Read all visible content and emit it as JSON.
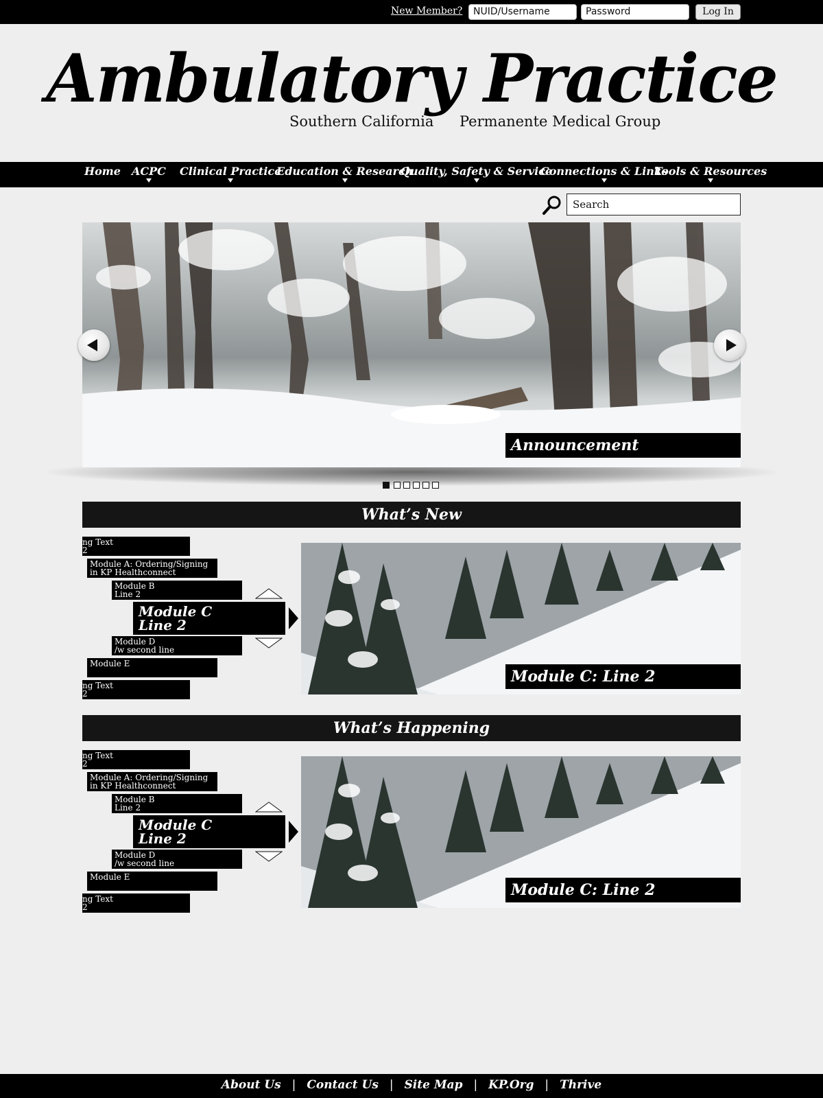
{
  "topbar": {
    "new_member": "New Member?",
    "username_placeholder": "NUID/Username",
    "password_placeholder": "Password",
    "login_label": "Log In"
  },
  "masthead": {
    "title": "Ambulatory Practice",
    "subtitle_left": "Southern California",
    "subtitle_right": "Permanente Medical Group"
  },
  "nav": {
    "items": [
      {
        "label": "Home"
      },
      {
        "label": "ACPC"
      },
      {
        "label": "Clinical Practice"
      },
      {
        "label": "Education & Research"
      },
      {
        "label": "Quality, Safety & Service"
      },
      {
        "label": "Connections & Links"
      },
      {
        "label": "Tools & Resources"
      }
    ]
  },
  "search": {
    "placeholder": "Search",
    "icon": "magnifier-icon"
  },
  "hero": {
    "caption": "Announcement",
    "slide_count": 6,
    "active_slide": 1,
    "prev_icon": "arrow-left-icon",
    "next_icon": "arrow-right-icon"
  },
  "whats_new": {
    "title": "What’s New",
    "modules": {
      "top_cut": [
        "ng Text",
        "2"
      ],
      "a": [
        "Module A: Ordering/Signing",
        "in KP Healthconnect"
      ],
      "b": [
        "Module B",
        "Line 2"
      ],
      "c": [
        "Module C",
        "Line 2"
      ],
      "d": [
        "Module D",
        "/w second line"
      ],
      "e": [
        "Module E"
      ],
      "bottom_cut": [
        "ng Text",
        "2"
      ]
    },
    "feature_caption": "Module C: Line 2"
  },
  "whats_happening": {
    "title": "What’s Happening",
    "modules": {
      "top_cut": [
        "ng Text",
        "2"
      ],
      "a": [
        "Module A: Ordering/Signing",
        "in KP Healthconnect"
      ],
      "b": [
        "Module B",
        "Line 2"
      ],
      "c": [
        "Module C",
        "Line 2"
      ],
      "d": [
        "Module D",
        "/w second line"
      ],
      "e": [
        "Module E"
      ],
      "bottom_cut": [
        "ng Text",
        "2"
      ]
    },
    "feature_caption": "Module C: Line 2"
  },
  "footer": {
    "links": [
      "About Us",
      "Contact Us",
      "Site Map",
      "KP.Org",
      "Thrive"
    ],
    "separator": "|"
  }
}
